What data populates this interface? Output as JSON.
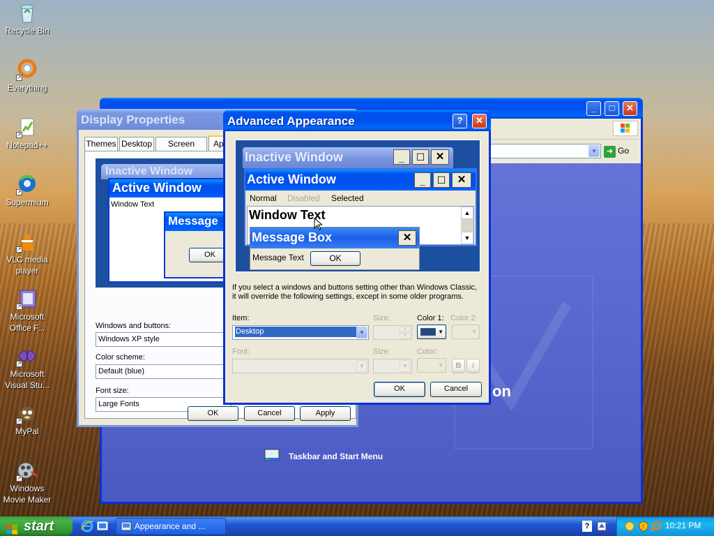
{
  "desktop": {
    "icons": [
      {
        "label": "Recycle Bin",
        "icon": "recycle-bin-icon"
      },
      {
        "label": "Everything",
        "icon": "everything-icon"
      },
      {
        "label": "Notepad++",
        "icon": "notepadpp-icon"
      },
      {
        "label": "Supermium",
        "icon": "supermium-icon"
      },
      {
        "label": "VLC media player",
        "icon": "vlc-icon"
      },
      {
        "label": "Microsoft Office F...",
        "icon": "office-icon"
      },
      {
        "label": "Microsoft Visual Stu...",
        "icon": "visual-studio-icon"
      },
      {
        "label": "MyPal",
        "icon": "mypal-icon"
      },
      {
        "label": "Windows Movie Maker",
        "icon": "movie-maker-icon"
      }
    ]
  },
  "bg_window": {
    "address_go": "Go",
    "heading_fragment": "on",
    "link_label": "Taskbar and Start Menu"
  },
  "display_properties": {
    "title": "Display Properties",
    "tabs": [
      "Themes",
      "Desktop",
      "Screen Saver",
      "Ap"
    ],
    "preview": {
      "inactive": "Inactive Window",
      "active": "Active Window",
      "window_text": "Window Text",
      "message": "Message",
      "ok": "OK"
    },
    "windows_buttons_label": "Windows and buttons:",
    "windows_buttons_value": "Windows XP style",
    "color_scheme_label": "Color scheme:",
    "color_scheme_value": "Default (blue)",
    "font_size_label": "Font size:",
    "font_size_value": "Large Fonts",
    "ok": "OK",
    "cancel": "Cancel",
    "apply": "Apply"
  },
  "advanced": {
    "title": "Advanced Appearance",
    "help_btn": "?",
    "preview": {
      "inactive": "Inactive Window",
      "active": "Active Window",
      "menu_normal": "Normal",
      "menu_disabled": "Disabled",
      "menu_selected": "Selected",
      "window_text": "Window Text",
      "message_box": "Message Box",
      "message_text": "Message Text",
      "ok": "OK"
    },
    "info_line1": "If you select a windows and buttons setting other than Windows Classic,",
    "info_line2": "it will override the following settings, except in some older programs.",
    "item_label": "Item:",
    "item_value": "Desktop",
    "size_label": "Size:",
    "color1_label": "Color 1:",
    "color2_label": "Color 2:",
    "font_label": "Font:",
    "font_size_label": "Size:",
    "font_color_label": "Color:",
    "bold": "B",
    "italic": "I",
    "ok": "OK",
    "cancel": "Cancel",
    "color1_value": "#1a4a8f"
  },
  "taskbar": {
    "start": "start",
    "task_label": "Appearance and ...",
    "clock": "10:21 PM"
  }
}
